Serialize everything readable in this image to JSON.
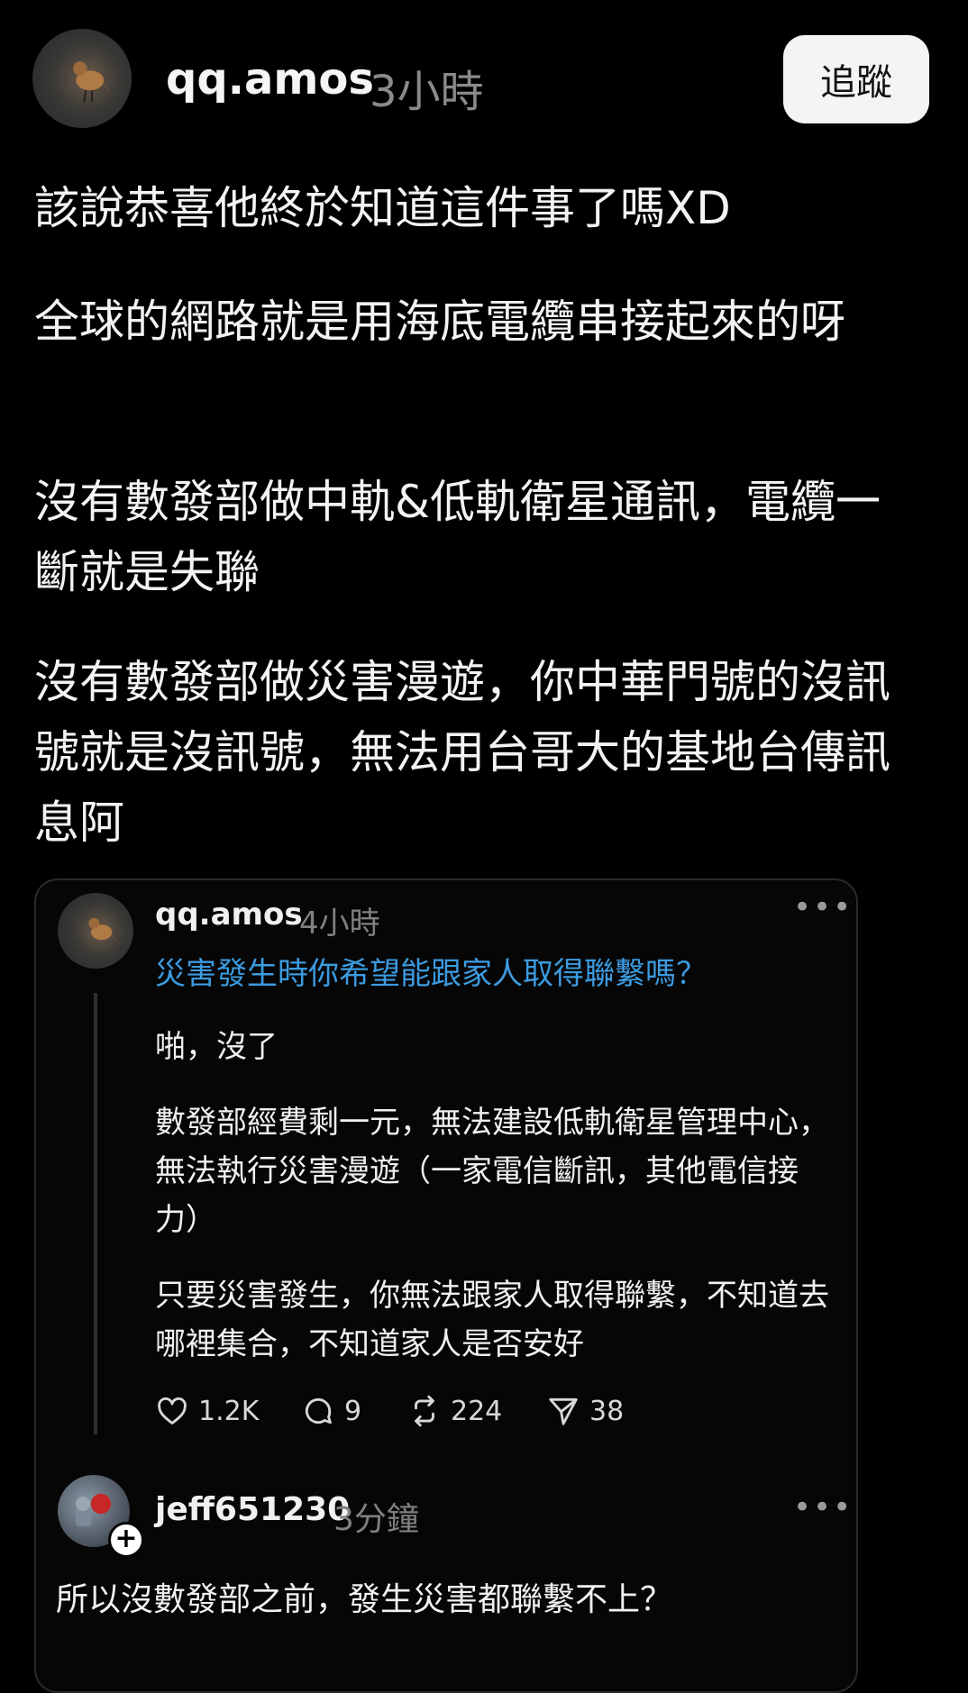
{
  "post": {
    "username": "qq.amos",
    "time": "3小時",
    "follow_label": "追蹤",
    "paragraphs": [
      "該說恭喜他終於知道這件事了嗎XD",
      "全球的網路就是用海底電纜串接起來的呀",
      "沒有數發部做中軌&低軌衛星通訊，電纜一斷就是失聯",
      "沒有數發部做災害漫遊，你中華門號的沒訊號就是沒訊號，無法用台哥大的基地台傳訊息阿"
    ]
  },
  "quoted": {
    "username": "qq.amos",
    "time": "4小時",
    "more": "•••",
    "link_text": "災害發生時你希望能跟家人取得聯繫嗎？",
    "paragraphs": [
      "啪，沒了",
      "數發部經費剩一元，無法建設低軌衛星管理中心，無法執行災害漫遊（一家電信斷訊，其他電信接力）",
      "只要災害發生，你無法跟家人取得聯繫，不知道去哪裡集合，不知道家人是否安好"
    ],
    "actions": {
      "likes": "1.2K",
      "replies": "9",
      "reposts": "224",
      "shares": "38"
    }
  },
  "reply": {
    "username": "jeff651230",
    "time": "3分鐘",
    "more": "•••",
    "plus": "+",
    "text": "所以沒數發部之前，發生災害都聯繫不上？"
  },
  "icons": {
    "like": "heart-icon",
    "reply": "comment-icon",
    "repost": "repost-icon",
    "share": "send-icon"
  },
  "colors": {
    "background": "#000000",
    "link": "#3c9be0",
    "muted": "#8a8a8a",
    "follow_button": "#f4f4f4"
  }
}
